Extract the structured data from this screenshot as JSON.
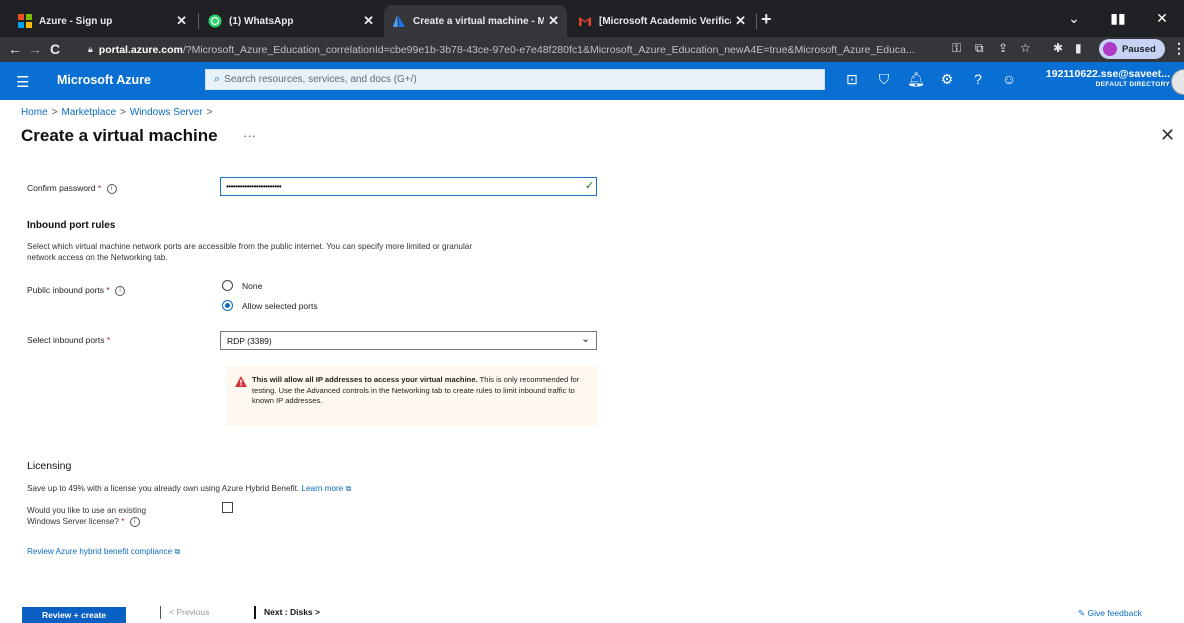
{
  "browser": {
    "tabs": [
      {
        "title": "Azure - Sign up",
        "active": false
      },
      {
        "title": "(1) WhatsApp",
        "active": false
      },
      {
        "title": "Create a virtual machine - Micro",
        "active": true
      },
      {
        "title": "[Microsoft Academic Verification",
        "active": false
      }
    ],
    "new_tab": "+",
    "window_controls": {
      "minimize": "⌄",
      "maximize": "▮▮",
      "close": "✕"
    },
    "url_host": "portal.azure.com",
    "url_rest": "/?Microsoft_Azure_Education_correlationId=cbe99e1b-3b78-43ce-97e0-e7e48f280fc1&Microsoft_Azure_Education_newA4E=true&Microsoft_Azure_Educa...",
    "profile_status": "Paused"
  },
  "azure": {
    "brand": "Microsoft Azure",
    "search_placeholder": "Search resources, services, and docs (G+/)",
    "account_user": "192110622.sse@saveet...",
    "account_dir": "DEFAULT DIRECTORY"
  },
  "breadcrumb": [
    "Home",
    "Marketplace",
    "Windows Server"
  ],
  "page": {
    "title": "Create a virtual machine",
    "more": "···",
    "close": "✕"
  },
  "form": {
    "confirm_password": {
      "label": "Confirm password",
      "value": "••••••••••••••••••••••••"
    },
    "inbound": {
      "heading": "Inbound port rules",
      "description_line1": "Select which virtual machine network ports are accessible from the public internet. You can specify more limited or granular",
      "description_line2": "network access on the Networking tab.",
      "public_ports_label": "Public inbound ports",
      "options": [
        "None",
        "Allow selected ports"
      ],
      "selected_option": "Allow selected ports",
      "select_ports_label": "Select inbound ports",
      "select_ports_value": "RDP (3389)"
    },
    "warning": {
      "bold": "This will allow all IP addresses to access your virtual machine.",
      "text": " This is only recommended for testing. Use the Advanced controls in the Networking tab to create rules to limit inbound traffic to known IP addresses."
    },
    "licensing": {
      "heading": "Licensing",
      "description": "Save up to 49% with a license you already own using Azure Hybrid Benefit.",
      "learn_more": "Learn more",
      "question_line1": "Would you like to use an existing",
      "question_line2": "Windows Server license?",
      "review_link": "Review Azure hybrid benefit compliance"
    }
  },
  "footer": {
    "review_create": "Review + create",
    "previous": "< Previous",
    "next": "Next : Disks >",
    "feedback": "Give feedback"
  },
  "colors": {
    "azure_blue": "#0a6fd2",
    "link": "#0f6cbd",
    "warning": "#d13438",
    "success": "#107c10"
  }
}
